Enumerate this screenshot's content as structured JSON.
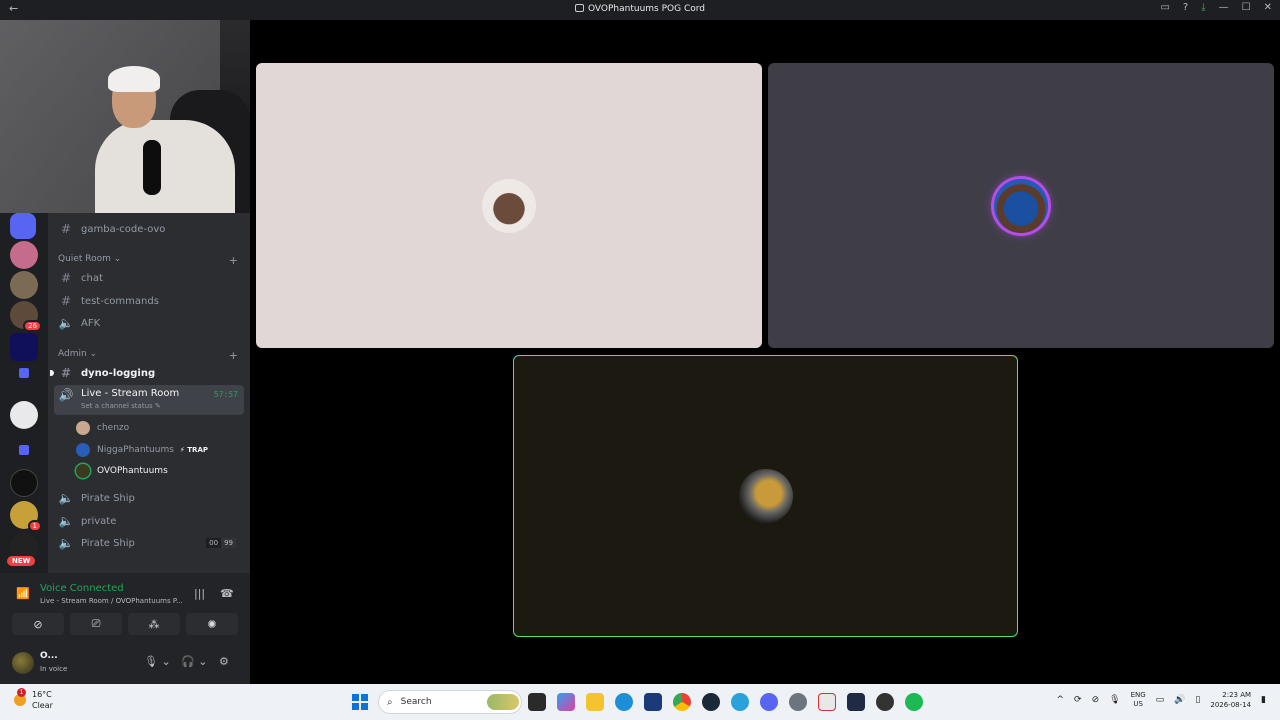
{
  "window": {
    "title": "OVOPhantuums POG Cord",
    "back_icon": "arrow-left-icon"
  },
  "servers": {
    "badges": [
      "26",
      "1"
    ],
    "new_label": "NEW"
  },
  "sidebar": {
    "top_channel": "gamba-code-ovo",
    "categories": [
      {
        "name": "Quiet Room",
        "channels": [
          "chat",
          "test-commands",
          "AFK"
        ]
      },
      {
        "name": "Admin"
      }
    ],
    "admin_channels": {
      "dyno": "dyno-logging",
      "live": {
        "name": "Live - Stream Room",
        "timer": "57:57",
        "status_hint": "Set a channel status"
      },
      "voice_users": [
        {
          "name": "chenzo"
        },
        {
          "name": "NiggaPhantuums",
          "tag": "TRAP"
        },
        {
          "name": "OVOPhantuums"
        }
      ],
      "after": [
        "Pirate Ship",
        "private",
        "Pirate Ship"
      ],
      "limit": [
        "00",
        "99"
      ]
    }
  },
  "voice": {
    "title": "Voice Connected",
    "subtitle": "Live - Stream Room / OVOPhantuums P..."
  },
  "user": {
    "name": "O...",
    "status": "In voice"
  },
  "taskbar": {
    "weather_temp": "16°C",
    "weather_desc": "Clear",
    "search_placeholder": "Search",
    "lang_line1": "ENG",
    "lang_line2": "US",
    "time": "2:23 AM",
    "date": "2026-08-14"
  },
  "colors": {
    "accent_green": "#23a559",
    "speaking_green": "#5ae06a",
    "purple_ring": "#b64de8"
  }
}
